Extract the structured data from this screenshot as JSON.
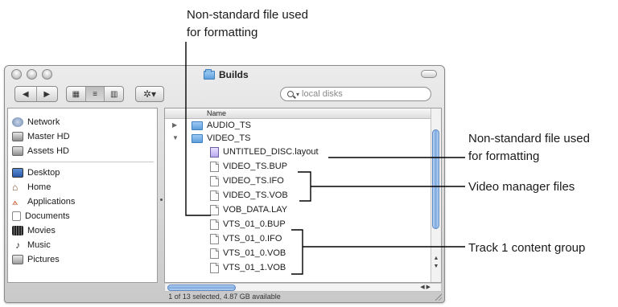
{
  "callouts": {
    "top_line1": "Non-standard file used",
    "top_line2": "for formatting",
    "right1_line1": "Non-standard file used",
    "right1_line2": "for formatting",
    "right2": "Video manager files",
    "right3": "Track 1 content group"
  },
  "window": {
    "title": "Builds",
    "search_placeholder": "local disks",
    "status": "1 of 13 selected, 4.87 GB available"
  },
  "sidebar": {
    "items": [
      {
        "label": "Network",
        "icon": "network-icon"
      },
      {
        "label": "Master HD",
        "icon": "hard-drive-icon"
      },
      {
        "label": "Assets HD",
        "icon": "hard-drive-icon"
      },
      {
        "label": "Desktop",
        "icon": "desktop-icon"
      },
      {
        "label": "Home",
        "icon": "home-icon"
      },
      {
        "label": "Applications",
        "icon": "applications-icon"
      },
      {
        "label": "Documents",
        "icon": "documents-icon"
      },
      {
        "label": "Movies",
        "icon": "movies-icon"
      },
      {
        "label": "Music",
        "icon": "music-icon"
      },
      {
        "label": "Pictures",
        "icon": "pictures-icon"
      }
    ]
  },
  "list": {
    "column_name": "Name",
    "rows": [
      {
        "name": "AUDIO_TS",
        "kind": "folder",
        "disclosure": "collapsed"
      },
      {
        "name": "VIDEO_TS",
        "kind": "folder",
        "disclosure": "expanded"
      },
      {
        "name": "UNTITLED_DISC.layout",
        "kind": "layout"
      },
      {
        "name": "VIDEO_TS.BUP",
        "kind": "file"
      },
      {
        "name": "VIDEO_TS.IFO",
        "kind": "file"
      },
      {
        "name": "VIDEO_TS.VOB",
        "kind": "file"
      },
      {
        "name": "VOB_DATA.LAY",
        "kind": "file"
      },
      {
        "name": "VTS_01_0.BUP",
        "kind": "file"
      },
      {
        "name": "VTS_01_0.IFO",
        "kind": "file"
      },
      {
        "name": "VTS_01_0.VOB",
        "kind": "file"
      },
      {
        "name": "VTS_01_1.VOB",
        "kind": "file"
      }
    ]
  },
  "colors": {
    "folder_blue": "#5e9fdc",
    "scroll_blue": "#7da9df",
    "chrome_gray": "#c9c9c9"
  }
}
